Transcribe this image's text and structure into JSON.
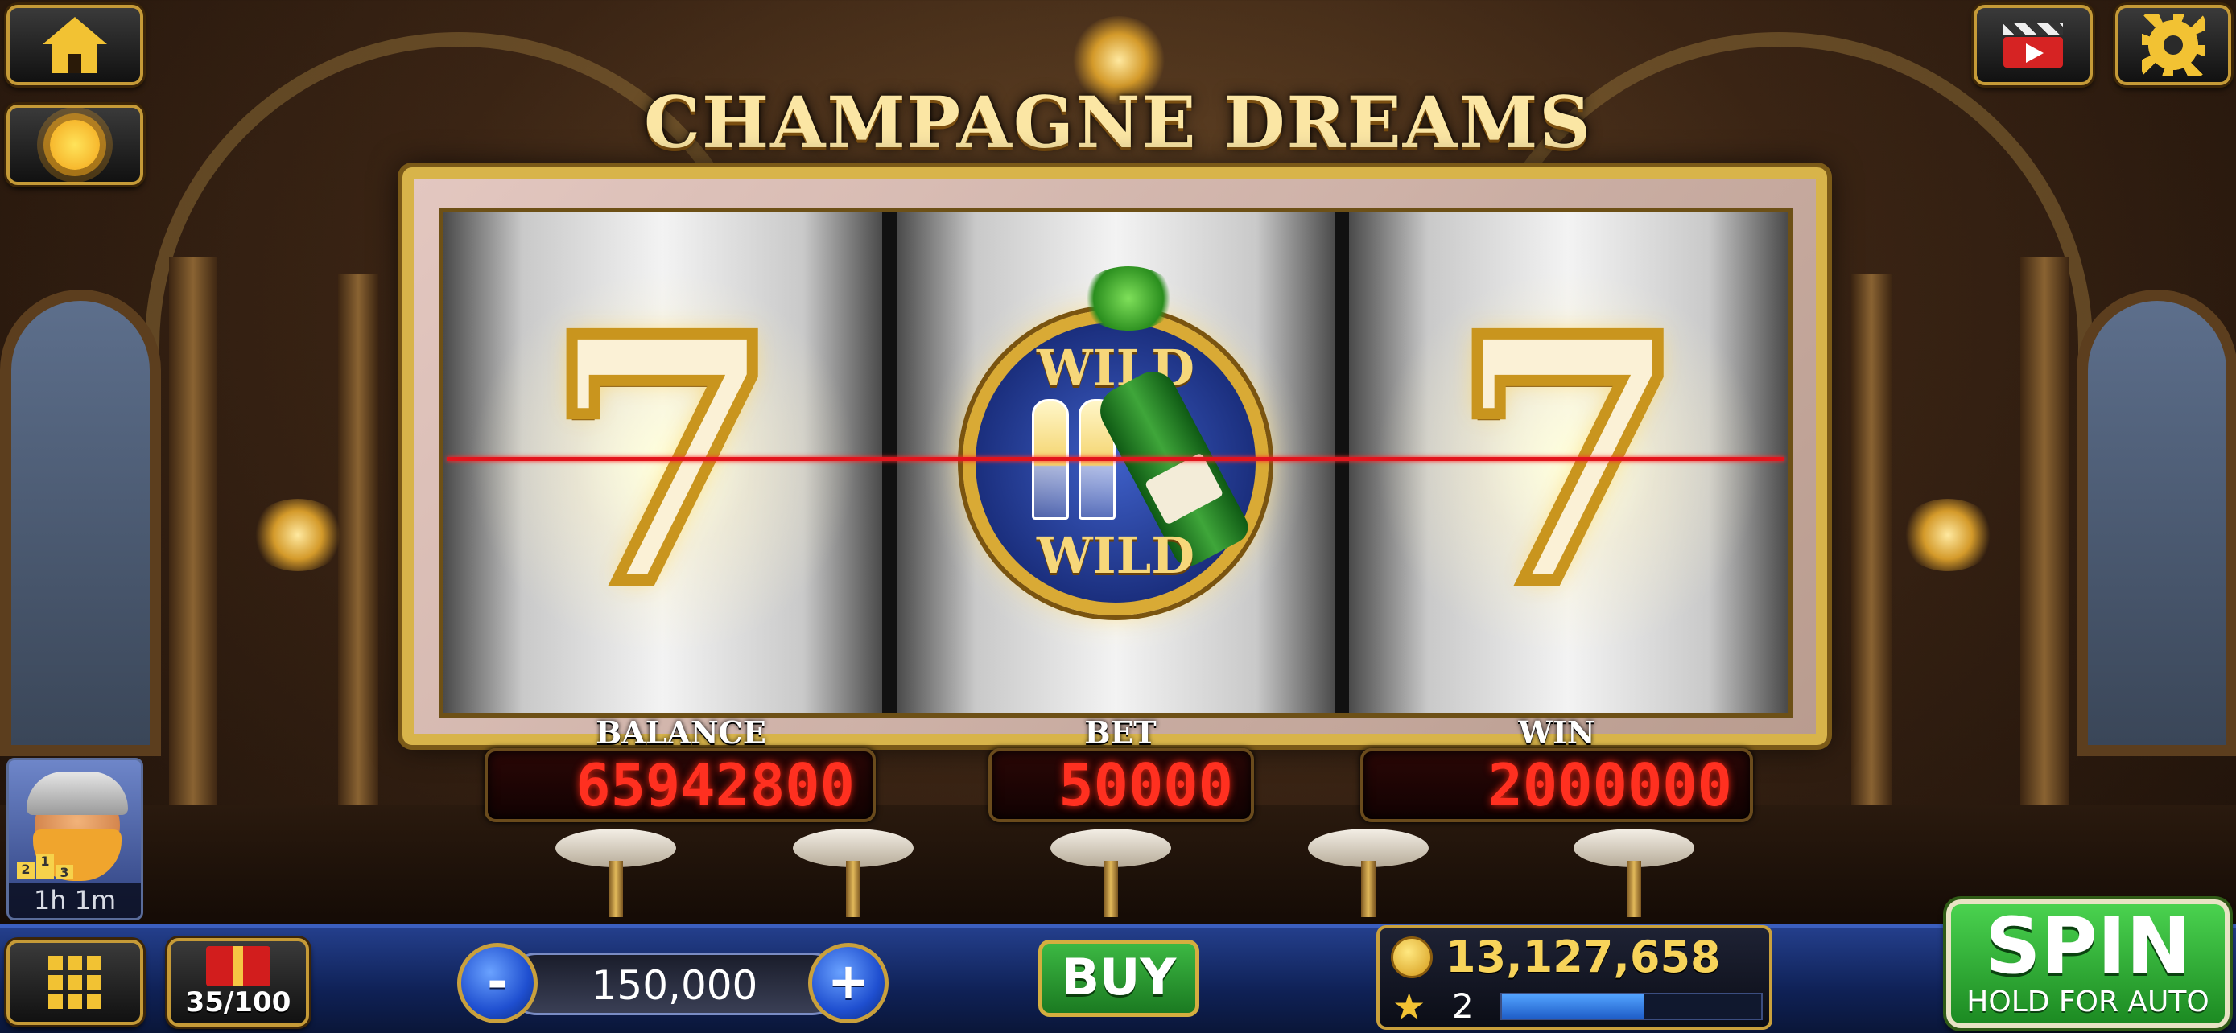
{
  "game": {
    "title": "CHAMPAGNE DREAMS"
  },
  "reels": [
    {
      "symbol": "7",
      "icon": "seven-symbol"
    },
    {
      "symbol": "WILD",
      "icon": "champagne-wild-symbol",
      "top_text": "WILD",
      "bottom_text": "WILD"
    },
    {
      "symbol": "7",
      "icon": "seven-symbol"
    }
  ],
  "meters": {
    "balance_label": "BALANCE",
    "balance_value": "65942800",
    "bet_label": "BET",
    "bet_value": "50000",
    "win_label": "WIN",
    "win_value": "2000000"
  },
  "side": {
    "home_icon": "home-icon",
    "daily_bonus_icon": "sun-icon",
    "video_icon": "video-icon",
    "settings_icon": "gear-icon",
    "avatar_timer": "1h  1m",
    "podium": [
      "2",
      "1",
      "3"
    ]
  },
  "bottom": {
    "menu_icon": "grid-menu-icon",
    "gift_count": "35/100",
    "bet_amount": "150,000",
    "minus_label": "-",
    "plus_label": "+",
    "buy_label": "BUY",
    "coins": "13,127,658",
    "level": "2",
    "xp_fraction": 0.55,
    "spin_label": "SPIN",
    "spin_sub": "HOLD FOR AUTO"
  },
  "colors": {
    "meter_digits": "#ff3020",
    "gold": "#d8b44a",
    "spin_green": "#2fae35",
    "bar_blue": "#0f2156",
    "payline": "#e2141c"
  }
}
